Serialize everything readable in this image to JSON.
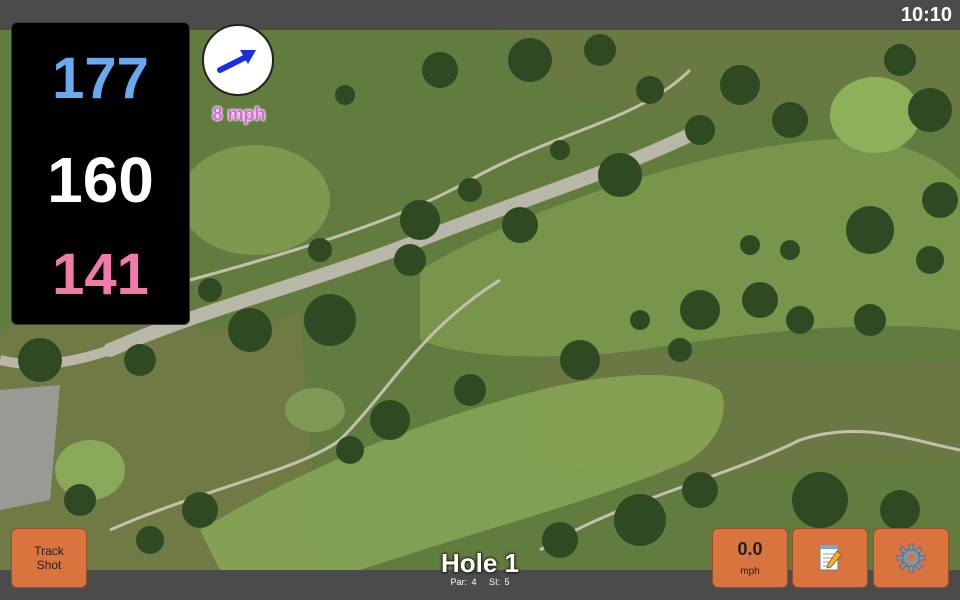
{
  "status": {
    "time": "10:10"
  },
  "distances": {
    "back": "177",
    "center": "160",
    "front": "141"
  },
  "wind": {
    "speed_label": "8 mph",
    "direction_icon": "wind-arrow-icon"
  },
  "buttons": {
    "track_shot_line1": "Track",
    "track_shot_line2": "Shot",
    "speed_value": "0.0",
    "speed_unit": "mph",
    "notes_icon": "notepad-icon",
    "settings_icon": "gear-icon"
  },
  "hole": {
    "title": "Hole 1",
    "par": "Par: 4",
    "si": "SI: 5"
  },
  "colors": {
    "back": "#6aa8f0",
    "center": "#ffffff",
    "front": "#f07aa8",
    "wind": "#e060e8",
    "button": "#d9743f"
  }
}
